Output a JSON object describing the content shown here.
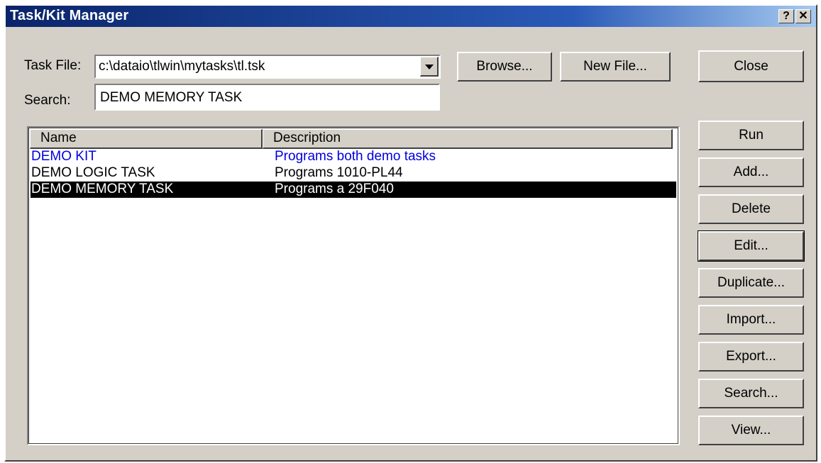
{
  "window": {
    "title": "Task/Kit Manager",
    "help_glyph": "?",
    "close_glyph": "✕"
  },
  "task_file": {
    "label": "Task File:",
    "value": "c:\\dataio\\tlwin\\mytasks\\tl.tsk"
  },
  "search": {
    "label": "Search:",
    "value": "DEMO MEMORY TASK"
  },
  "top_buttons": {
    "browse": "Browse...",
    "new_file": "New File...",
    "close": "Close"
  },
  "list": {
    "columns": [
      "Name",
      "Description"
    ],
    "rows": [
      {
        "name": "DEMO KIT",
        "description": "Programs both demo tasks",
        "type": "kit"
      },
      {
        "name": "DEMO LOGIC TASK",
        "description": "Programs 1010-PL44",
        "type": "task"
      },
      {
        "name": "DEMO MEMORY TASK",
        "description": "Programs a 29F040",
        "type": "task",
        "selected": true
      }
    ]
  },
  "side_buttons": {
    "run": "Run",
    "add": "Add...",
    "delete": "Delete",
    "edit": "Edit...",
    "duplicate": "Duplicate...",
    "import": "Import...",
    "export": "Export...",
    "search": "Search...",
    "view": "View..."
  },
  "colors": {
    "kit_text": "#0000e0",
    "selection_bg": "#000000",
    "title_bar": "#0a246a"
  }
}
